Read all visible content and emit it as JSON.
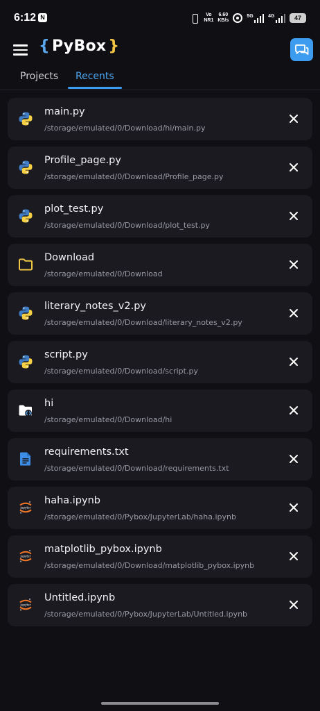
{
  "status_bar": {
    "time": "6:12",
    "notification_label": "N",
    "volte": "Vo",
    "volte_sub": "NR1",
    "speed_value": "6.60",
    "speed_unit": "KB/s",
    "network_5g": "5G",
    "network_4g": "4G",
    "battery": "47"
  },
  "app_bar": {
    "brace_open": "{",
    "title": "PyBox",
    "brace_close": "}",
    "menu_icon": "hamburger-menu-icon",
    "chat_icon": "chat-bubbles-icon",
    "accent_color": "#3d9cf0"
  },
  "tabs": [
    {
      "label": "Projects",
      "selected": false
    },
    {
      "label": "Recents",
      "selected": true
    }
  ],
  "recents": [
    {
      "name": "main.py",
      "path": "/storage/emulated/0/Download/hi/main.py",
      "icon": "python-icon"
    },
    {
      "name": "Profile_page.py",
      "path": "/storage/emulated/0/Download/Profile_page.py",
      "icon": "python-icon"
    },
    {
      "name": "plot_test.py",
      "path": "/storage/emulated/0/Download/plot_test.py",
      "icon": "python-icon"
    },
    {
      "name": "Download",
      "path": "/storage/emulated/0/Download",
      "icon": "folder-outline-icon"
    },
    {
      "name": "literary_notes_v2.py",
      "path": "/storage/emulated/0/Download/literary_notes_v2.py",
      "icon": "python-icon"
    },
    {
      "name": "script.py",
      "path": "/storage/emulated/0/Download/script.py",
      "icon": "python-icon"
    },
    {
      "name": "hi",
      "path": "/storage/emulated/0/Download/hi",
      "icon": "code-folder-icon"
    },
    {
      "name": "requirements.txt",
      "path": "/storage/emulated/0/Download/requirements.txt",
      "icon": "text-document-icon"
    },
    {
      "name": "haha.ipynb",
      "path": "/storage/emulated/0/Pybox/JupyterLab/haha.ipynb",
      "icon": "jupyter-icon"
    },
    {
      "name": "matplotlib_pybox.ipynb",
      "path": "/storage/emulated/0/Download/matplotlib_pybox.ipynb",
      "icon": "jupyter-icon"
    },
    {
      "name": "Untitled.ipynb",
      "path": "/storage/emulated/0/Pybox/JupyterLab/Untitled.ipynb",
      "icon": "jupyter-icon"
    }
  ]
}
